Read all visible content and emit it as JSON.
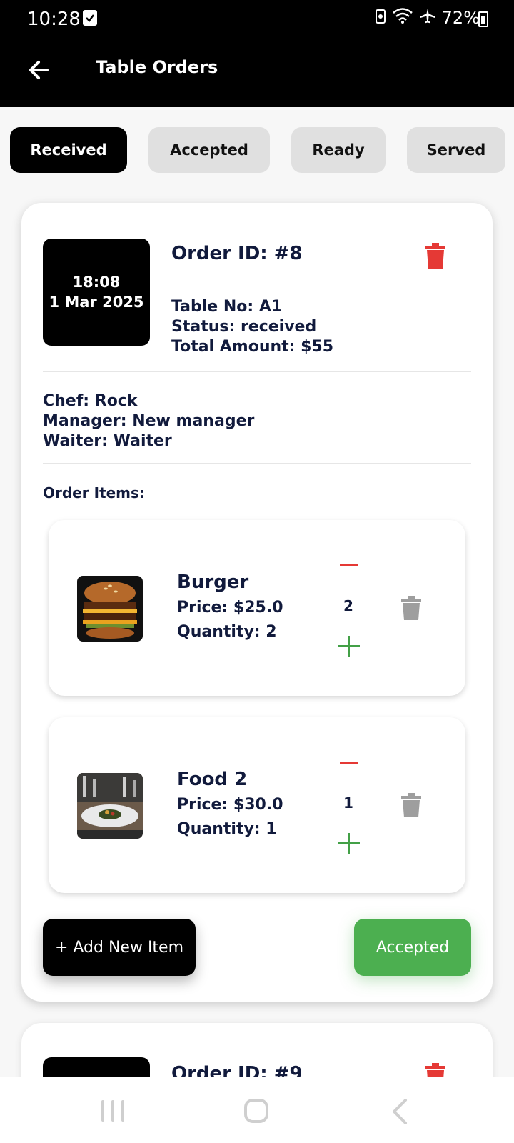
{
  "status_bar": {
    "time": "10:28",
    "battery": "72%",
    "icons": [
      "check-box-icon",
      "battery-saver-icon",
      "wifi-icon",
      "airplane-icon",
      "battery-icon"
    ]
  },
  "app_bar": {
    "title": "Table Orders",
    "back_icon": "arrow-left-icon"
  },
  "tabs": [
    {
      "label": "Received",
      "active": true
    },
    {
      "label": "Accepted",
      "active": false
    },
    {
      "label": "Ready",
      "active": false
    },
    {
      "label": "Served",
      "active": false
    }
  ],
  "orders": [
    {
      "time": "18:08",
      "date": "1 Mar 2025",
      "order_id": "Order ID: #8",
      "table": "Table No: A1",
      "status": "Status: received",
      "total": "Total Amount: $55",
      "chef": "Chef: Rock",
      "manager": "Manager: New manager",
      "waiter": "Waiter: Waiter",
      "items_label": "Order Items:",
      "items": [
        {
          "name": "Burger",
          "price": "Price: $25.0",
          "quantity": "Quantity: 2",
          "qty_value": "2",
          "image": "burger-photo"
        },
        {
          "name": "Food 2",
          "price": "Price: $30.0",
          "quantity": "Quantity: 1",
          "qty_value": "1",
          "image": "plated-dish-photo"
        }
      ],
      "add_button": "+ Add New Item",
      "action_button": "Accepted"
    },
    {
      "order_id": "Order ID: #9"
    }
  ],
  "colors": {
    "accent_black": "#000000",
    "delete_red": "#e53935",
    "accept_green": "#4caf50",
    "tab_inactive": "#e0e0e0",
    "text_navy": "#111a3c"
  }
}
